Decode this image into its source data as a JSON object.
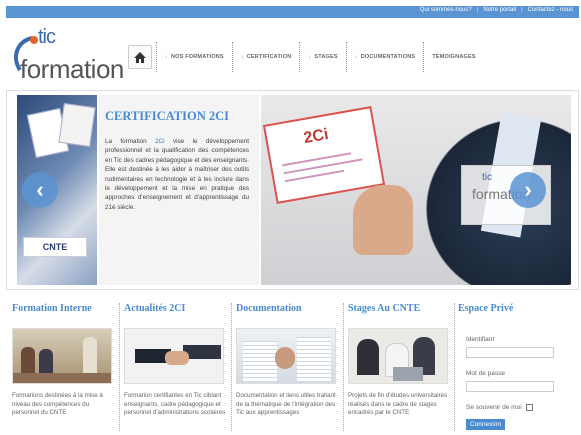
{
  "topbar": {
    "links": [
      "Qui sommes-nous?",
      "Notre portail",
      "Contactez - nous"
    ]
  },
  "logo": {
    "tic": "tic",
    "formation": "formation"
  },
  "nav": {
    "items": [
      "NOS FORMATIONS",
      "CERTIFICATION",
      "STAGES",
      "DOCUMENTATIONS",
      "TÉMOIGNAGES"
    ]
  },
  "slider": {
    "title": "CERTIFICATION 2CI",
    "desc_pre": "La formation ",
    "desc_hl": "2Ci",
    "desc_post": " vise le développement professionnel et la qualification des compétences en Tic des cadres pédagogique et des enseignants. Elle est destinée à les aider à maîtriser des outils rudimentaires en technologie et à les inclure dans le développement et la mise en pratique des approches d'enseignement et d'apprentissage du 21é siècle.",
    "cert_logo": "2Ci",
    "cnte_label": "CNTE",
    "mini_logo_tic": "tic",
    "mini_logo_formation": "formation"
  },
  "sections": [
    {
      "title": "Formation Interne",
      "text": "Formations destinées à la mise à niveau des compétences du personnel du CNTE"
    },
    {
      "title": "Actualités 2CI",
      "text": "Formation certifiantes en Tic ciblant enseignants, cadre pédagogique et personnel d'administrations scolaires"
    },
    {
      "title": "Documentation",
      "text": "Documentation et liens utiles traitant de la thématique de l'intégration des Tic aux apprentissages"
    },
    {
      "title": "Stages Au CNTE",
      "text": "Projets de fin d'études universitaires réalisés dans le cadre de stages encadrés par le CNTE"
    }
  ],
  "login": {
    "title": "Espace Privé",
    "id_label": "Identifiant",
    "pwd_label": "Mot de passe",
    "remember_label": "Se souvenir de moi",
    "submit": "Connexion"
  },
  "colors": {
    "accent": "#4a8bd0",
    "topbar": "#5a94d2"
  }
}
